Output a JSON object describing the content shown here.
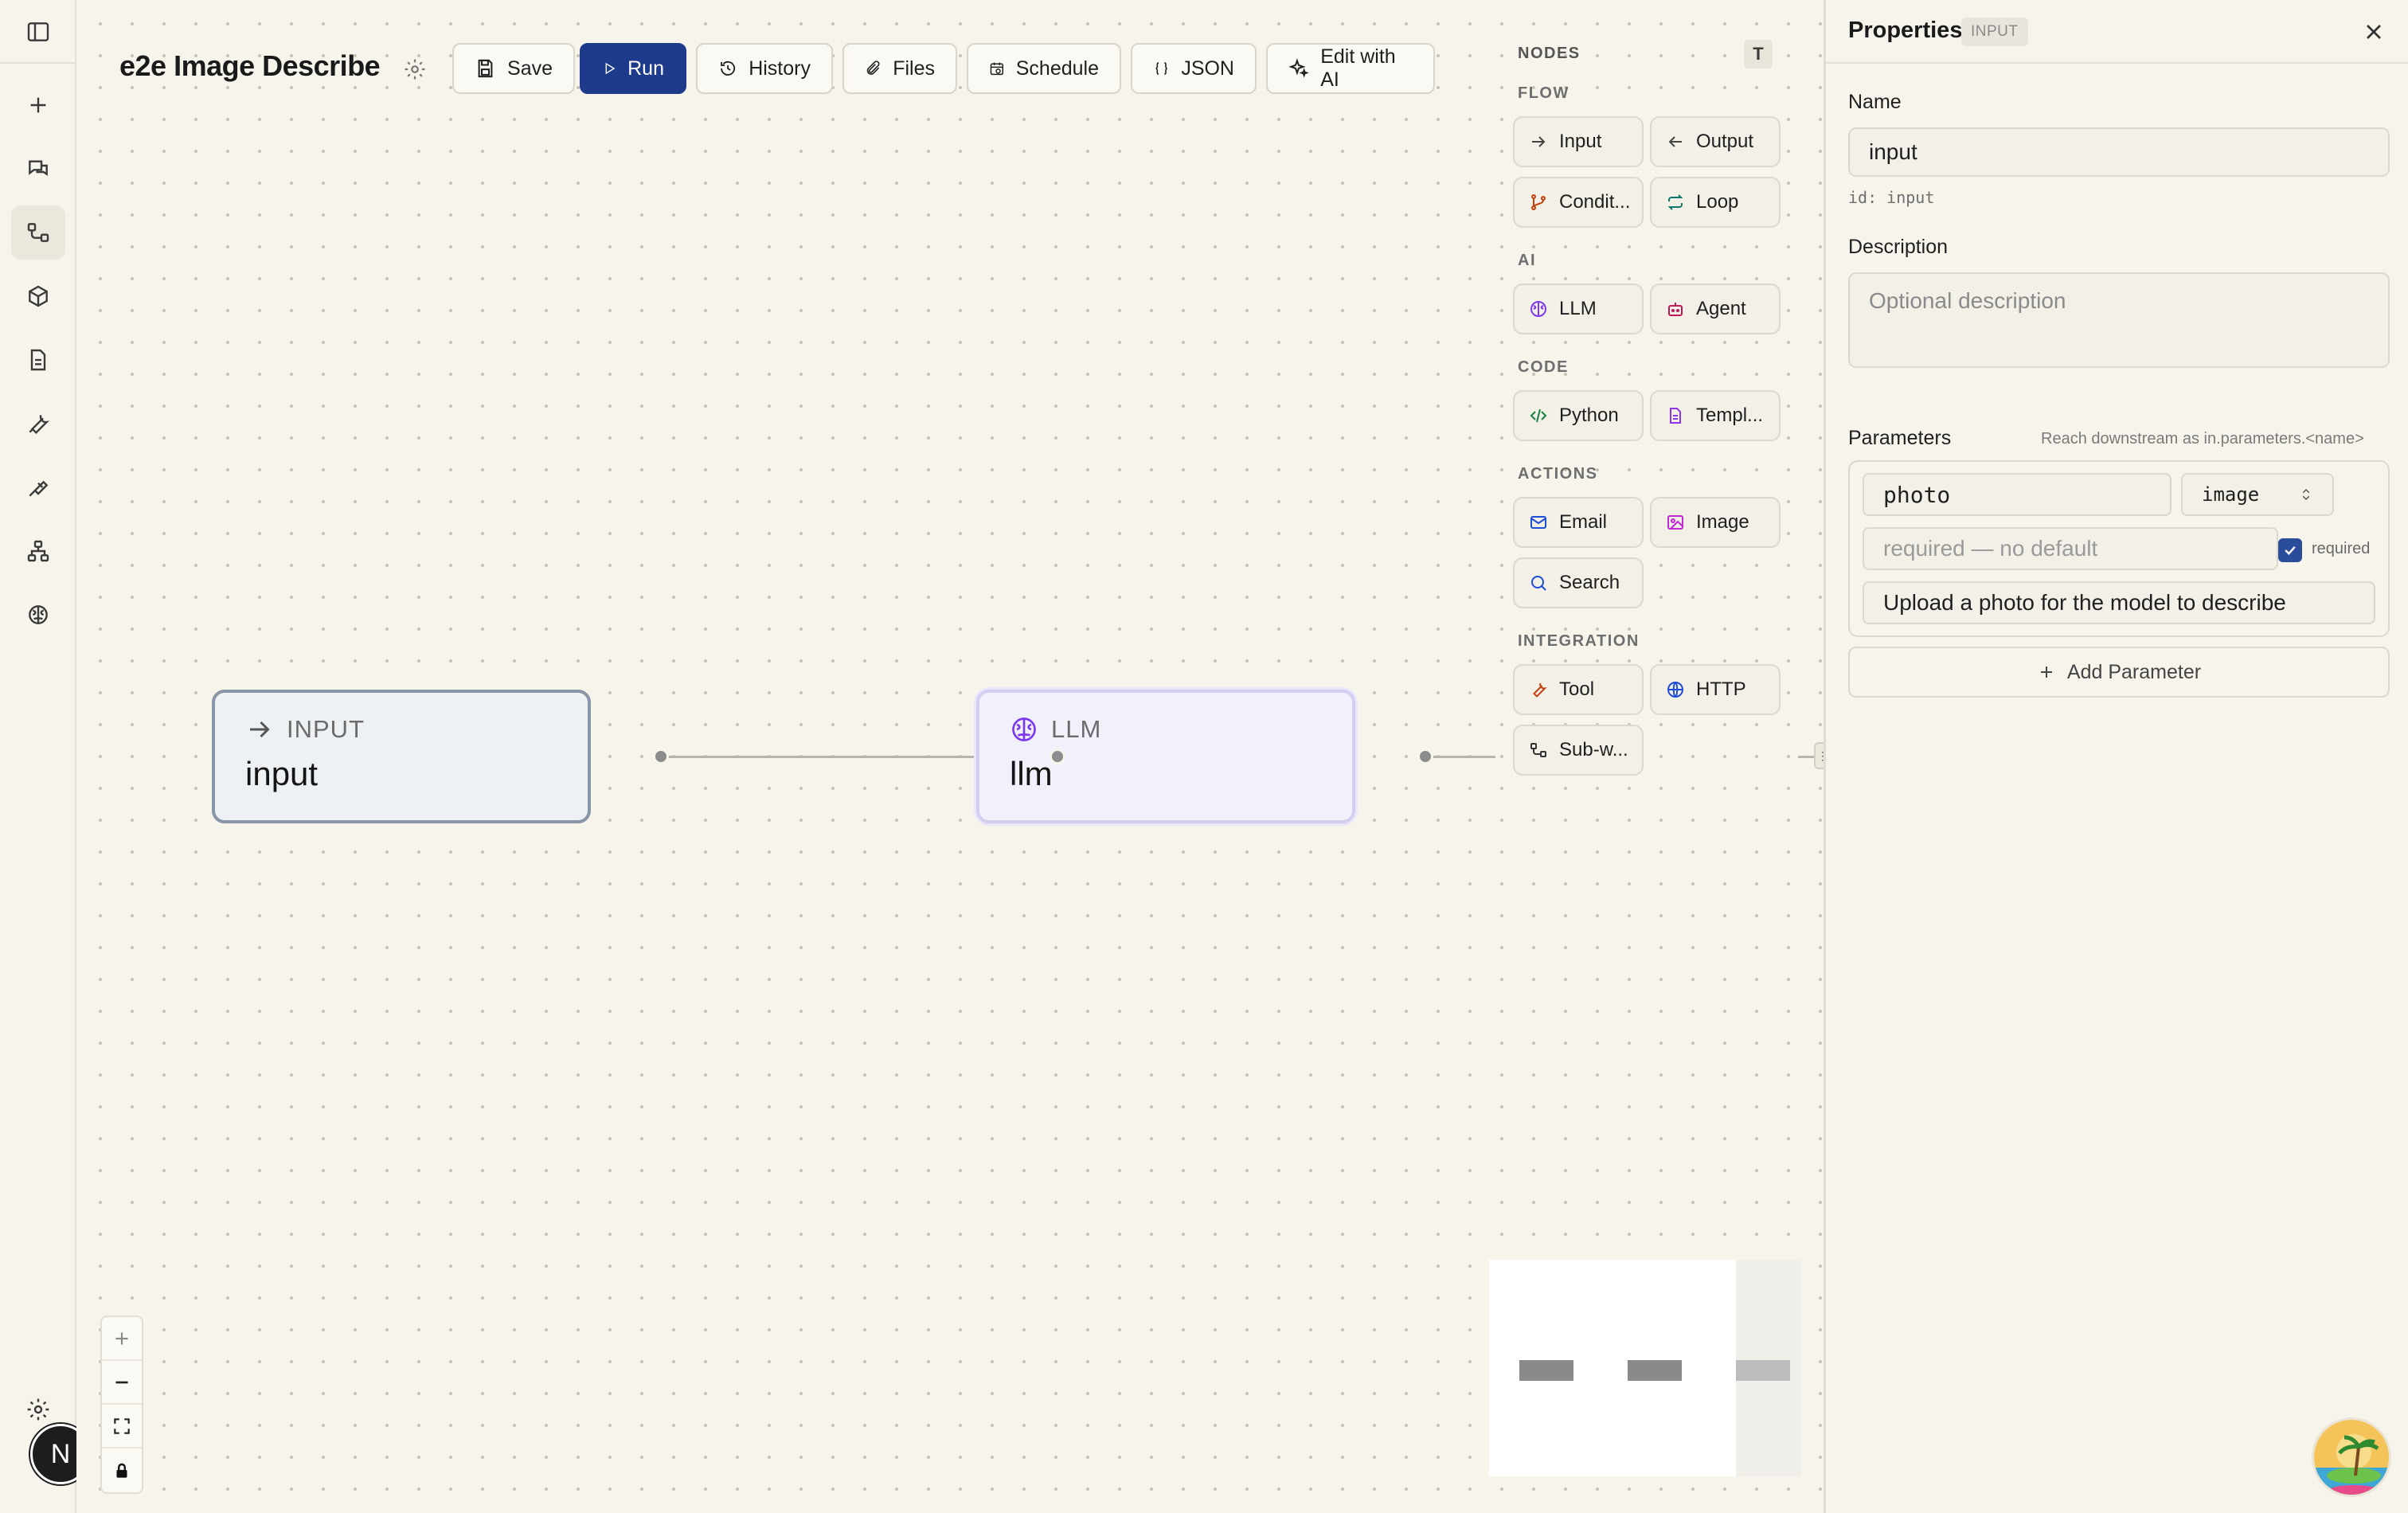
{
  "workflow": {
    "title": "e2e Image Describe"
  },
  "toolbar": {
    "save": "Save",
    "run": "Run",
    "history": "History",
    "files": "Files",
    "schedule": "Schedule",
    "json": "JSON",
    "edit_ai": "Edit with AI"
  },
  "rail": {
    "items": [
      "toggle-sidebar",
      "new",
      "chat",
      "workflows",
      "packages",
      "documents",
      "tools",
      "prompts",
      "org",
      "models",
      "settings"
    ],
    "avatar": "N"
  },
  "nodes": [
    {
      "type": "INPUT",
      "name": "input"
    },
    {
      "type": "LLM",
      "name": "llm"
    }
  ],
  "palette": {
    "heading": "NODES",
    "t_button": "T",
    "sections": {
      "flow": "FLOW",
      "ai": "AI",
      "code": "CODE",
      "actions": "ACTIONS",
      "integration": "INTEGRATION"
    },
    "items": {
      "input": "Input",
      "output": "Output",
      "condition": "Condit...",
      "loop": "Loop",
      "llm": "LLM",
      "agent": "Agent",
      "python": "Python",
      "template": "Templ...",
      "email": "Email",
      "image": "Image",
      "search": "Search",
      "tool": "Tool",
      "http": "HTTP",
      "subworkflow": "Sub-w..."
    }
  },
  "properties": {
    "title": "Properties",
    "badge": "INPUT",
    "name_label": "Name",
    "name_value": "input",
    "id_line": "id: input",
    "description_label": "Description",
    "description_placeholder": "Optional description",
    "parameters_label": "Parameters",
    "parameters_hint": "Reach downstream as in.parameters.<name>",
    "param": {
      "name": "photo",
      "type": "image",
      "default_placeholder": "required — no default",
      "required_label": "required",
      "required": true,
      "description": "Upload a photo for the model to describe"
    },
    "add_parameter": "Add Parameter"
  },
  "colors": {
    "primary": "#1e3a8a",
    "canvas_bg": "#f7f4ec",
    "input_node_border": "#8896a8",
    "llm_node_border": "#d3cdf0",
    "llm_icon": "#7c3aed"
  }
}
